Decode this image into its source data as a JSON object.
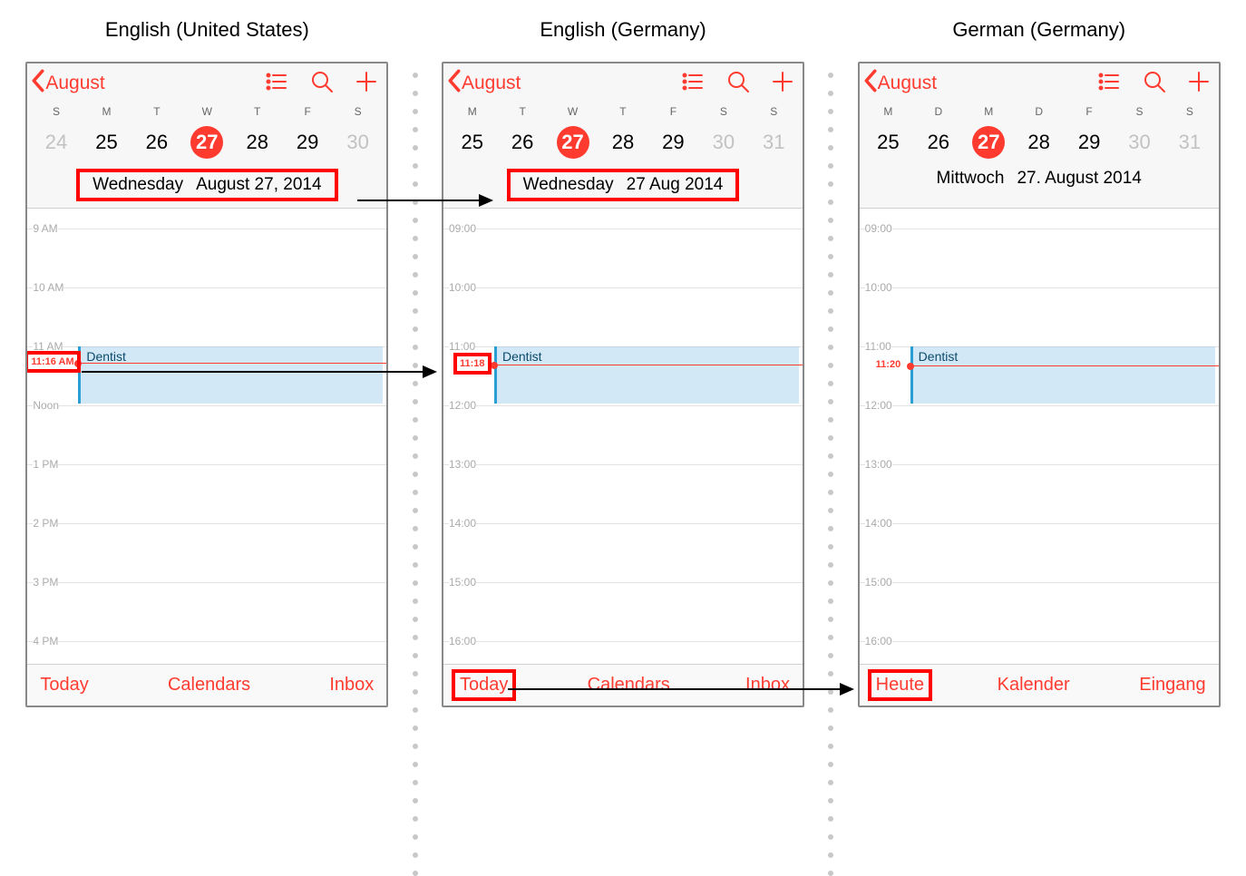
{
  "locales": {
    "us": "English (United States)",
    "en_de": "English (Germany)",
    "de_de": "German (Germany)"
  },
  "nav": {
    "back_month": "August"
  },
  "phones": {
    "us": {
      "week_letters": [
        "S",
        "M",
        "T",
        "W",
        "T",
        "F",
        "S"
      ],
      "days": [
        {
          "n": "24",
          "muted": true
        },
        {
          "n": "25"
        },
        {
          "n": "26"
        },
        {
          "n": "27",
          "today": true
        },
        {
          "n": "28"
        },
        {
          "n": "29"
        },
        {
          "n": "30",
          "muted": true
        }
      ],
      "weekday": "Wednesday",
      "datestr": "August 27, 2014",
      "hours": [
        "9 AM",
        "10 AM",
        "11 AM",
        "Noon",
        "1 PM",
        "2 PM",
        "3 PM",
        "4 PM"
      ],
      "now": "11:16 AM",
      "event": "Dentist",
      "footer": {
        "today": "Today",
        "calendars": "Calendars",
        "inbox": "Inbox"
      },
      "highlight_date": true,
      "highlight_now": true,
      "highlight_today_btn": false
    },
    "en_de": {
      "week_letters": [
        "M",
        "T",
        "W",
        "T",
        "F",
        "S",
        "S"
      ],
      "days": [
        {
          "n": "25"
        },
        {
          "n": "26"
        },
        {
          "n": "27",
          "today": true
        },
        {
          "n": "28"
        },
        {
          "n": "29"
        },
        {
          "n": "30",
          "muted": true
        },
        {
          "n": "31",
          "muted": true
        }
      ],
      "weekday": "Wednesday",
      "datestr": "27 Aug 2014",
      "hours": [
        "09:00",
        "10:00",
        "11:00",
        "12:00",
        "13:00",
        "14:00",
        "15:00",
        "16:00"
      ],
      "now": "11:18",
      "event": "Dentist",
      "footer": {
        "today": "Today",
        "calendars": "Calendars",
        "inbox": "Inbox"
      },
      "highlight_date": true,
      "highlight_now": true,
      "highlight_today_btn": true
    },
    "de_de": {
      "week_letters": [
        "M",
        "D",
        "M",
        "D",
        "F",
        "S",
        "S"
      ],
      "days": [
        {
          "n": "25"
        },
        {
          "n": "26"
        },
        {
          "n": "27",
          "today": true
        },
        {
          "n": "28"
        },
        {
          "n": "29"
        },
        {
          "n": "30",
          "muted": true
        },
        {
          "n": "31",
          "muted": true
        }
      ],
      "weekday": "Mittwoch",
      "datestr": "27. August 2014",
      "hours": [
        "09:00",
        "10:00",
        "11:00",
        "12:00",
        "13:00",
        "14:00",
        "15:00",
        "16:00"
      ],
      "now": "11:20",
      "event": "Dentist",
      "footer": {
        "today": "Heute",
        "calendars": "Kalender",
        "inbox": "Eingang"
      },
      "highlight_date": false,
      "highlight_now": false,
      "highlight_today_btn": true
    }
  }
}
